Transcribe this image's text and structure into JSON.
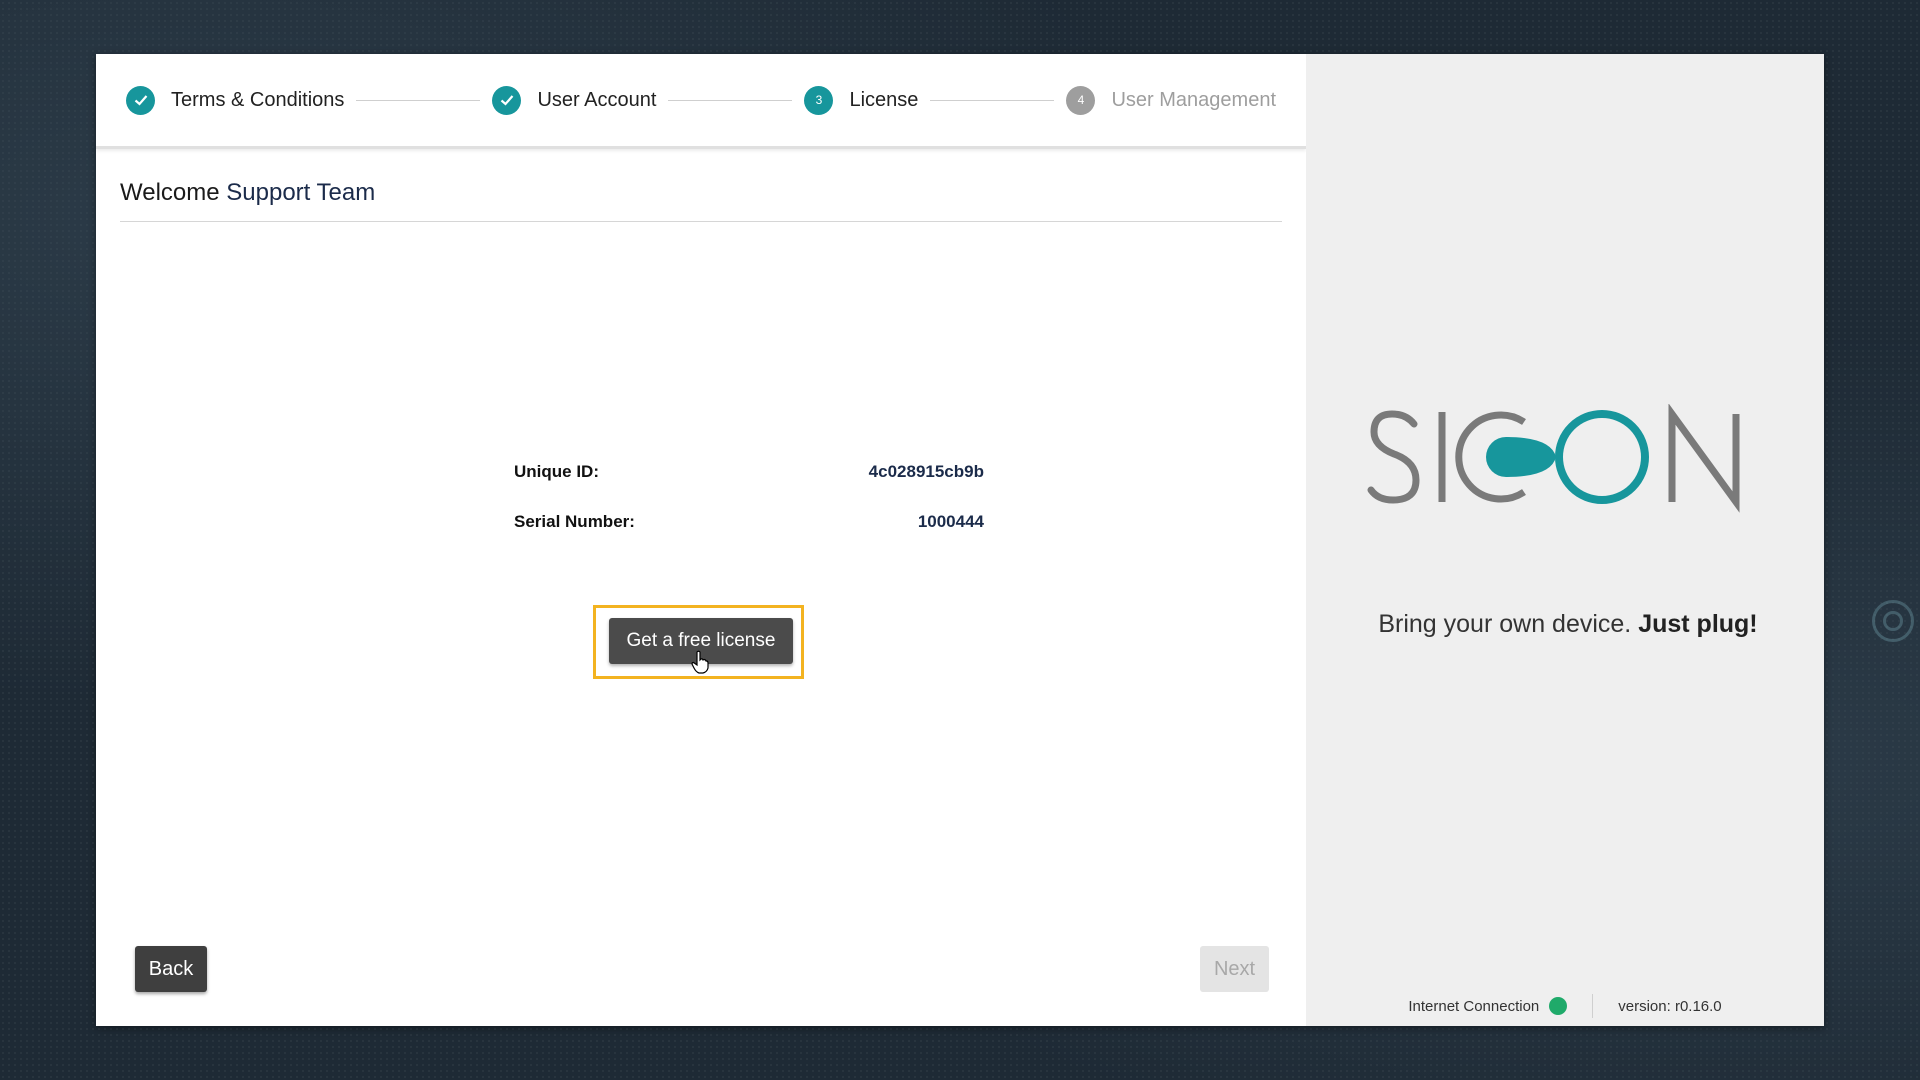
{
  "stepper": {
    "steps": [
      {
        "label": "Terms & Conditions",
        "state": "done",
        "number": ""
      },
      {
        "label": "User Account",
        "state": "done",
        "number": ""
      },
      {
        "label": "License",
        "state": "active",
        "number": "3"
      },
      {
        "label": "User Management",
        "state": "todo",
        "number": "4"
      }
    ]
  },
  "welcome": {
    "prefix": "Welcome ",
    "name": "Support Team"
  },
  "license_info": {
    "unique_id_label": "Unique ID:",
    "unique_id": "4c028915cb9b",
    "serial_label": "Serial Number:",
    "serial": "1000444"
  },
  "actions": {
    "get_license": "Get a free license",
    "back": "Back",
    "next": "Next"
  },
  "brand": {
    "logo_text": "SICON",
    "tagline_plain": "Bring your own device. ",
    "tagline_bold": "Just plug!"
  },
  "status": {
    "connection_label": "Internet Connection",
    "connection_state": "connected",
    "version": "version: r0.16.0"
  },
  "colors": {
    "accent": "#17969c",
    "logo_gray": "#7a7a7a",
    "highlight": "#f3b320",
    "connected": "#1faa6a"
  }
}
